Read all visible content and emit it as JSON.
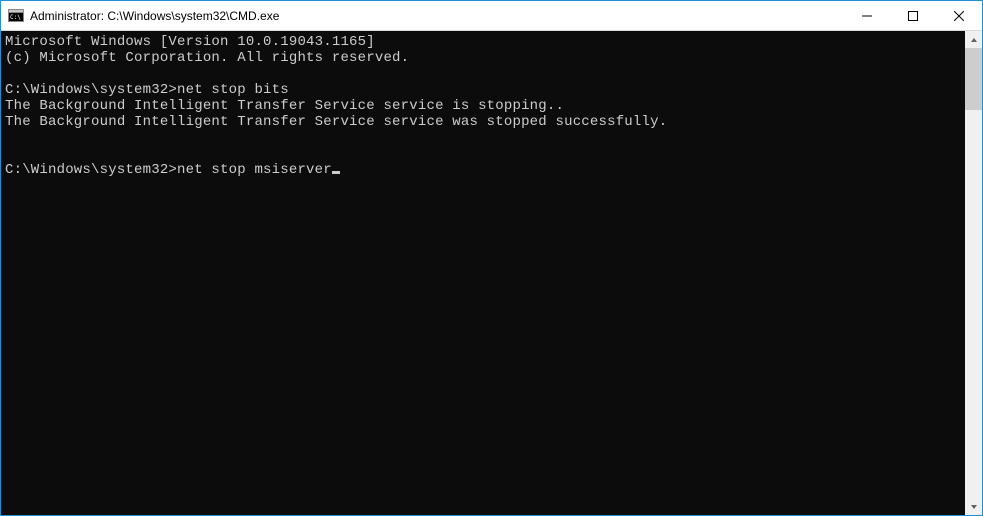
{
  "titlebar": {
    "title": "Administrator: C:\\Windows\\system32\\CMD.exe"
  },
  "terminal": {
    "lines": [
      "Microsoft Windows [Version 10.0.19043.1165]",
      "(c) Microsoft Corporation. All rights reserved.",
      "",
      "C:\\Windows\\system32>net stop bits",
      "The Background Intelligent Transfer Service service is stopping..",
      "The Background Intelligent Transfer Service service was stopped successfully.",
      "",
      ""
    ],
    "current_prompt": "C:\\Windows\\system32>",
    "current_input": "net stop msiserver"
  }
}
